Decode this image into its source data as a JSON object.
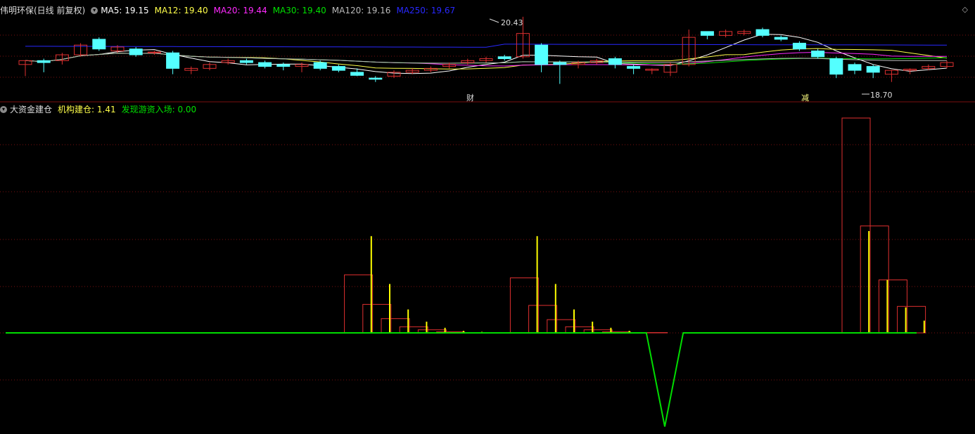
{
  "colors": {
    "background": "#000000",
    "grid": "#7a1010",
    "up": "#e03030",
    "down": "#54ffff",
    "ma5": "#ffffff",
    "ma12": "#ffff4a",
    "ma20": "#ff2aff",
    "ma30": "#00e000",
    "ma120": "#bbbbbb",
    "ma250": "#2828ff",
    "zero_line": "#00dd00",
    "yellow_bar": "#ffff00",
    "red_box": "#e03030"
  },
  "top_panel": {
    "stock_title": "伟明环保(日线 前复权)",
    "ma5": "MA5: 19.15",
    "ma12": "MA12: 19.40",
    "ma20": "MA20: 19.44",
    "ma30": "MA30: 19.40",
    "ma120": "MA120: 19.16",
    "ma250": "MA250: 19.67",
    "high_marker": "20.43",
    "low_marker": "18.70",
    "event_cai": "财",
    "event_jian": "减",
    "expand_icon": "diamond-icon"
  },
  "bottom_panel": {
    "indicator_name": "大资金建仓",
    "jigou_label": "机构建仓: 1.41",
    "faxian_label": "发现游资入场: 0.00"
  },
  "chart_data": [
    {
      "type": "candlestick",
      "title": "伟明环保(日线 前复权)",
      "series": [
        {
          "name": "MA5",
          "value": 19.15
        },
        {
          "name": "MA12",
          "value": 19.4
        },
        {
          "name": "MA20",
          "value": 19.44
        },
        {
          "name": "MA30",
          "value": 19.4
        },
        {
          "name": "MA120",
          "value": 19.16
        },
        {
          "name": "MA250",
          "value": 19.67
        }
      ],
      "candles": [
        [
          19.2,
          19.3,
          18.9,
          19.3
        ],
        [
          19.3,
          19.35,
          19.0,
          19.25
        ],
        [
          19.3,
          19.5,
          19.2,
          19.45
        ],
        [
          19.45,
          19.75,
          19.4,
          19.7
        ],
        [
          19.85,
          19.9,
          19.55,
          19.6
        ],
        [
          19.55,
          19.7,
          19.5,
          19.65
        ],
        [
          19.6,
          19.65,
          19.4,
          19.45
        ],
        [
          19.5,
          19.55,
          19.45,
          19.52
        ],
        [
          19.5,
          19.55,
          18.95,
          19.1
        ],
        [
          19.05,
          19.15,
          18.95,
          19.1
        ],
        [
          19.1,
          19.25,
          19.05,
          19.2
        ],
        [
          19.25,
          19.35,
          19.2,
          19.3
        ],
        [
          19.3,
          19.35,
          19.2,
          19.25
        ],
        [
          19.25,
          19.3,
          19.1,
          19.15
        ],
        [
          19.2,
          19.25,
          19.05,
          19.15
        ],
        [
          19.15,
          19.25,
          19.0,
          19.2
        ],
        [
          19.25,
          19.3,
          19.05,
          19.1
        ],
        [
          19.15,
          19.2,
          19.0,
          19.05
        ],
        [
          19.0,
          19.1,
          18.9,
          18.92
        ],
        [
          18.85,
          18.9,
          18.75,
          18.82
        ],
        [
          18.9,
          19.05,
          18.85,
          19.0
        ],
        [
          19.0,
          19.1,
          18.95,
          19.05
        ],
        [
          19.05,
          19.15,
          19.0,
          19.1
        ],
        [
          19.15,
          19.25,
          19.1,
          19.2
        ],
        [
          19.25,
          19.35,
          19.2,
          19.3
        ],
        [
          19.3,
          19.4,
          19.25,
          19.35
        ],
        [
          19.4,
          19.45,
          19.3,
          19.35
        ],
        [
          19.4,
          20.43,
          19.35,
          20.0
        ],
        [
          19.7,
          19.75,
          19.0,
          19.2
        ],
        [
          19.25,
          19.3,
          18.7,
          19.2
        ],
        [
          19.2,
          19.3,
          19.1,
          19.25
        ],
        [
          19.25,
          19.35,
          19.2,
          19.3
        ],
        [
          19.35,
          19.4,
          19.1,
          19.2
        ],
        [
          19.15,
          19.2,
          18.95,
          19.1
        ],
        [
          19.05,
          19.1,
          18.95,
          19.08
        ],
        [
          19.0,
          19.25,
          18.9,
          19.2
        ],
        [
          19.2,
          20.1,
          19.15,
          19.9
        ],
        [
          20.05,
          20.05,
          19.85,
          19.95
        ],
        [
          19.95,
          20.1,
          19.9,
          20.05
        ],
        [
          20.0,
          20.1,
          19.95,
          20.05
        ],
        [
          20.1,
          20.15,
          19.9,
          19.95
        ],
        [
          19.9,
          19.95,
          19.8,
          19.85
        ],
        [
          19.75,
          19.8,
          19.55,
          19.6
        ],
        [
          19.55,
          19.6,
          19.35,
          19.4
        ],
        [
          19.35,
          19.4,
          18.85,
          18.95
        ],
        [
          19.2,
          19.25,
          18.95,
          19.05
        ],
        [
          19.15,
          19.2,
          18.85,
          19.0
        ],
        [
          18.95,
          19.05,
          18.75,
          19.05
        ],
        [
          19.05,
          19.1,
          18.95,
          19.08
        ],
        [
          19.1,
          19.2,
          19.05,
          19.15
        ],
        [
          19.15,
          19.3,
          19.1,
          19.25
        ]
      ]
    },
    {
      "type": "bar",
      "title": "大资金建仓",
      "series": [
        {
          "name": "机构建仓",
          "last": 1.41
        },
        {
          "name": "发现游资入场",
          "last": 0.0
        }
      ],
      "yellow_bars": [
        {
          "i": 19,
          "v": 0.95
        },
        {
          "i": 20,
          "v": 0.48
        },
        {
          "i": 21,
          "v": 0.23
        },
        {
          "i": 22,
          "v": 0.11
        },
        {
          "i": 23,
          "v": 0.05
        },
        {
          "i": 24,
          "v": 0.02
        },
        {
          "i": 25,
          "v": 0.01
        },
        {
          "i": 28,
          "v": 0.95
        },
        {
          "i": 29,
          "v": 0.48
        },
        {
          "i": 30,
          "v": 0.23
        },
        {
          "i": 31,
          "v": 0.11
        },
        {
          "i": 32,
          "v": 0.05
        },
        {
          "i": 33,
          "v": 0.02
        },
        {
          "i": 46,
          "v": 1.0
        },
        {
          "i": 47,
          "v": 0.52
        },
        {
          "i": 48,
          "v": 0.25
        },
        {
          "i": 49,
          "v": 0.12
        }
      ],
      "red_boxes": [
        {
          "i": 18,
          "v": 0.57
        },
        {
          "i": 19,
          "v": 0.28
        },
        {
          "i": 20,
          "v": 0.14
        },
        {
          "i": 21,
          "v": 0.06
        },
        {
          "i": 22,
          "v": 0.03
        },
        {
          "i": 23,
          "v": 0.01
        },
        {
          "i": 27,
          "v": 0.54
        },
        {
          "i": 28,
          "v": 0.27
        },
        {
          "i": 29,
          "v": 0.13
        },
        {
          "i": 30,
          "v": 0.06
        },
        {
          "i": 31,
          "v": 0.03
        },
        {
          "i": 32,
          "v": 0.01
        },
        {
          "i": 34,
          "v": 0.003
        },
        {
          "i": 45,
          "v": 2.11
        },
        {
          "i": 46,
          "v": 1.05
        },
        {
          "i": 47,
          "v": 0.52
        },
        {
          "i": 48,
          "v": 0.26
        }
      ],
      "green_line": [
        {
          "i": 0,
          "v": 0
        },
        {
          "i": 34,
          "v": 0
        },
        {
          "i": 35,
          "v": -0.92
        },
        {
          "i": 36,
          "v": 0
        },
        {
          "i": 50,
          "v": 0
        }
      ]
    }
  ]
}
